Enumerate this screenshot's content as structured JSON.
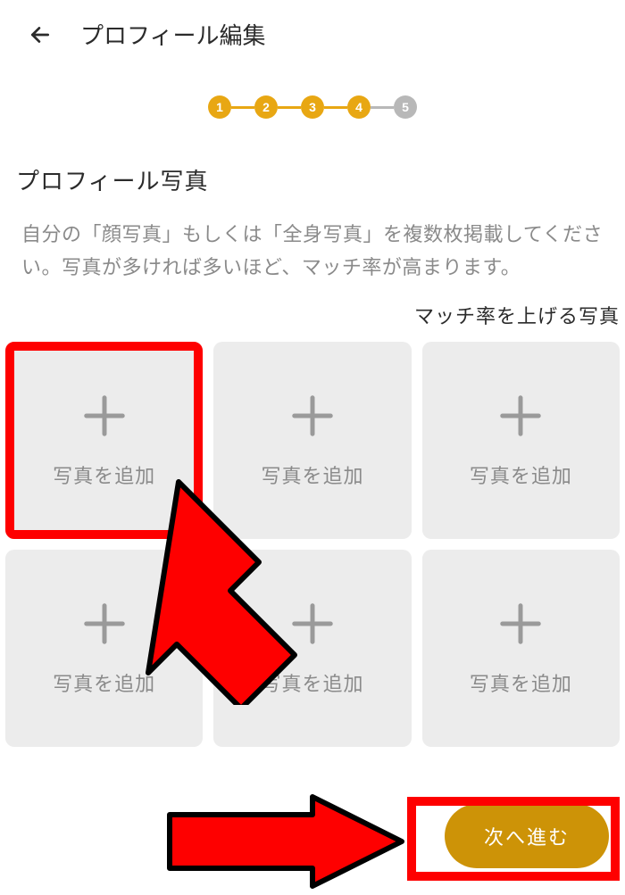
{
  "header": {
    "title": "プロフィール編集"
  },
  "stepper": {
    "steps": [
      "1",
      "2",
      "3",
      "4",
      "5"
    ],
    "active_count": 4
  },
  "section": {
    "title": "プロフィール写真",
    "description": "自分の「顔写真」もしくは「全身写真」を複数枚掲載してください。写真が多ければ多いほど、マッチ率が高まります。",
    "help_link": "マッチ率を上げる写真"
  },
  "photo_tiles": {
    "label": "写真を追加"
  },
  "next_button": {
    "label": "次へ進む"
  }
}
